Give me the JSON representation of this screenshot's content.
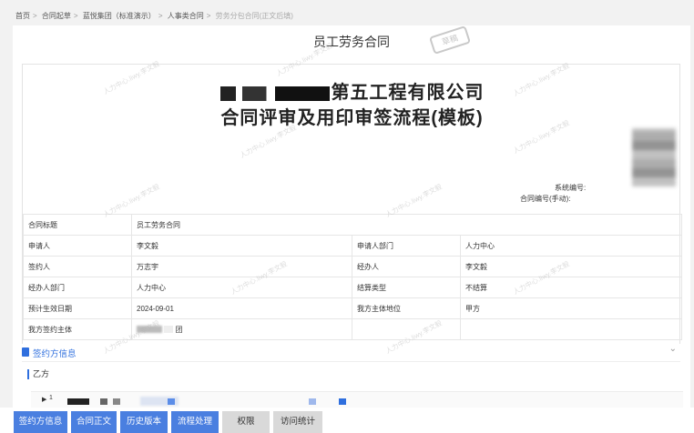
{
  "breadcrumb": {
    "items": [
      "首页",
      "合同起草",
      "蓝悦集团（标准演示）",
      "人事类合同",
      "劳务分包合同(正文后填)"
    ]
  },
  "document": {
    "title": "员工劳务合同",
    "stamp_text": "草稿",
    "company_suffix": "第五工程有限公司",
    "flow_title": "合同评审及用印审签流程(模板)",
    "system_no_label": "系统编号:",
    "contract_no_label": "合同编号(手动):"
  },
  "info_table": {
    "rows": [
      {
        "label1": "合同标题",
        "value1": "员工劳务合同"
      },
      {
        "label1": "申请人",
        "value1": "李文毅",
        "label2": "申请人部门",
        "value2": "人力中心"
      },
      {
        "label1": "签约人",
        "value1": "万志宇",
        "label2": "经办人",
        "value2": "李文毅"
      },
      {
        "label1": "经办人部门",
        "value1": "人力中心",
        "label2": "结算类型",
        "value2": "不结算"
      },
      {
        "label1": "预计生效日期",
        "value1": "2024-09-01",
        "label2": "我方主体地位",
        "value2": "甲方"
      },
      {
        "label1": "我方签约主体",
        "value1": "团",
        "label2": "",
        "value2": ""
      }
    ]
  },
  "signer_section": {
    "label": "签约方信息",
    "party_label": "乙方",
    "row_index": "1"
  },
  "watermark_text": "人力中心.liwy.李文毅",
  "tabs": [
    {
      "label": "签约方信息",
      "active": true
    },
    {
      "label": "合同正文",
      "active": true
    },
    {
      "label": "历史版本",
      "active": true
    },
    {
      "label": "流程处理",
      "active": true
    },
    {
      "label": "权限",
      "active": false
    },
    {
      "label": "访问统计",
      "active": false
    }
  ],
  "colors": {
    "accent": "#4a7fe0",
    "link": "#2f6fde"
  }
}
